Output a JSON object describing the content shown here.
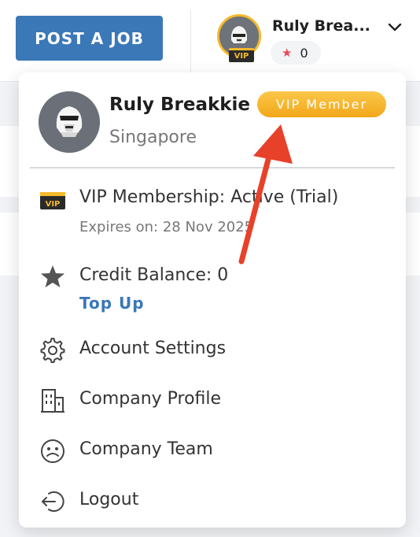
{
  "header": {
    "post_job_label": "POST A JOB",
    "user_name_short": "Ruly Brea...",
    "credit_count": "0",
    "vip_tag": "VIP"
  },
  "dropdown": {
    "user_name": "Ruly Breakkie",
    "vip_badge": "VIP Member",
    "location": "Singapore",
    "vip_status": "VIP Membership: Active (Trial)",
    "vip_expiry": "Expires on: 28 Nov 2025",
    "credit_balance": "Credit Balance: 0",
    "top_up": "Top Up",
    "menu": [
      {
        "label": "Account Settings",
        "icon": "gear-icon"
      },
      {
        "label": "Company Profile",
        "icon": "building-icon"
      },
      {
        "label": "Company Team",
        "icon": "team-face-icon"
      },
      {
        "label": "Logout",
        "icon": "logout-icon"
      }
    ]
  },
  "colors": {
    "accent": "#3a78b8",
    "vip_gold": "#f5b92c",
    "star_red": "#e64a5a",
    "arrow_red": "#e8412a"
  }
}
